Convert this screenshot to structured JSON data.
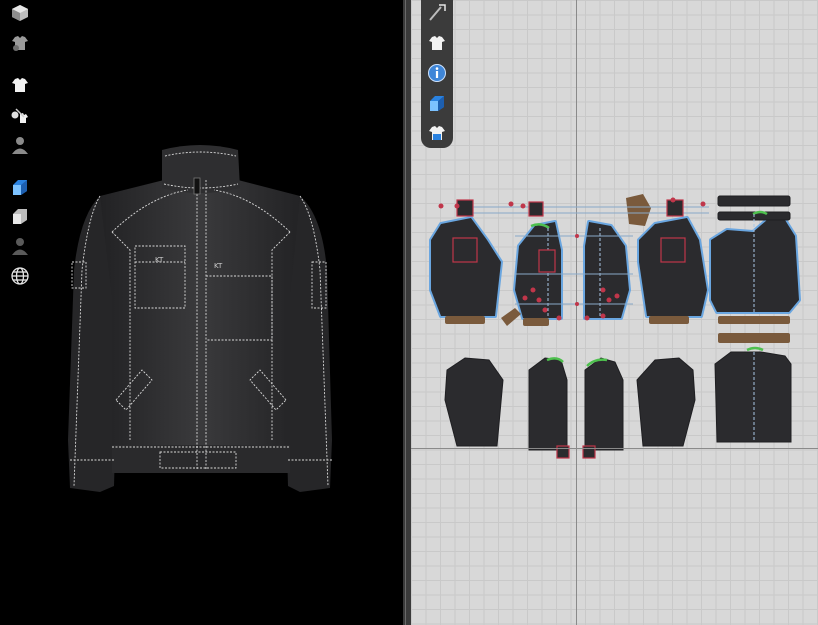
{
  "app": {
    "views": [
      "3d-garment-view",
      "2d-pattern-view"
    ]
  },
  "toolbar_3d": {
    "icons": [
      "avatar-box-icon",
      "garment-settings-icon",
      "show-garment-icon",
      "fabric-sewing-icon",
      "show-avatar-icon",
      "texture-icon",
      "fabric-render-icon",
      "avatar-silhouette-icon",
      "globe-icon"
    ]
  },
  "toolbar_2d": {
    "icons": [
      "pencil-icon",
      "show-garment-icon",
      "info-icon",
      "texture-icon",
      "lock-garment-icon"
    ]
  },
  "garment": {
    "type": "bomber jacket",
    "color": "#2c2c2e",
    "stitch_color": "#d9d9d9",
    "label_left": "KT",
    "label_right": "KT"
  },
  "colors": {
    "pattern_outline": "#6aa6e0",
    "pattern_fill": "#2b2b2e",
    "highlight_green": "#4ec04e",
    "trim_brown": "#7a5a3c",
    "pin_red": "#c0364a"
  }
}
